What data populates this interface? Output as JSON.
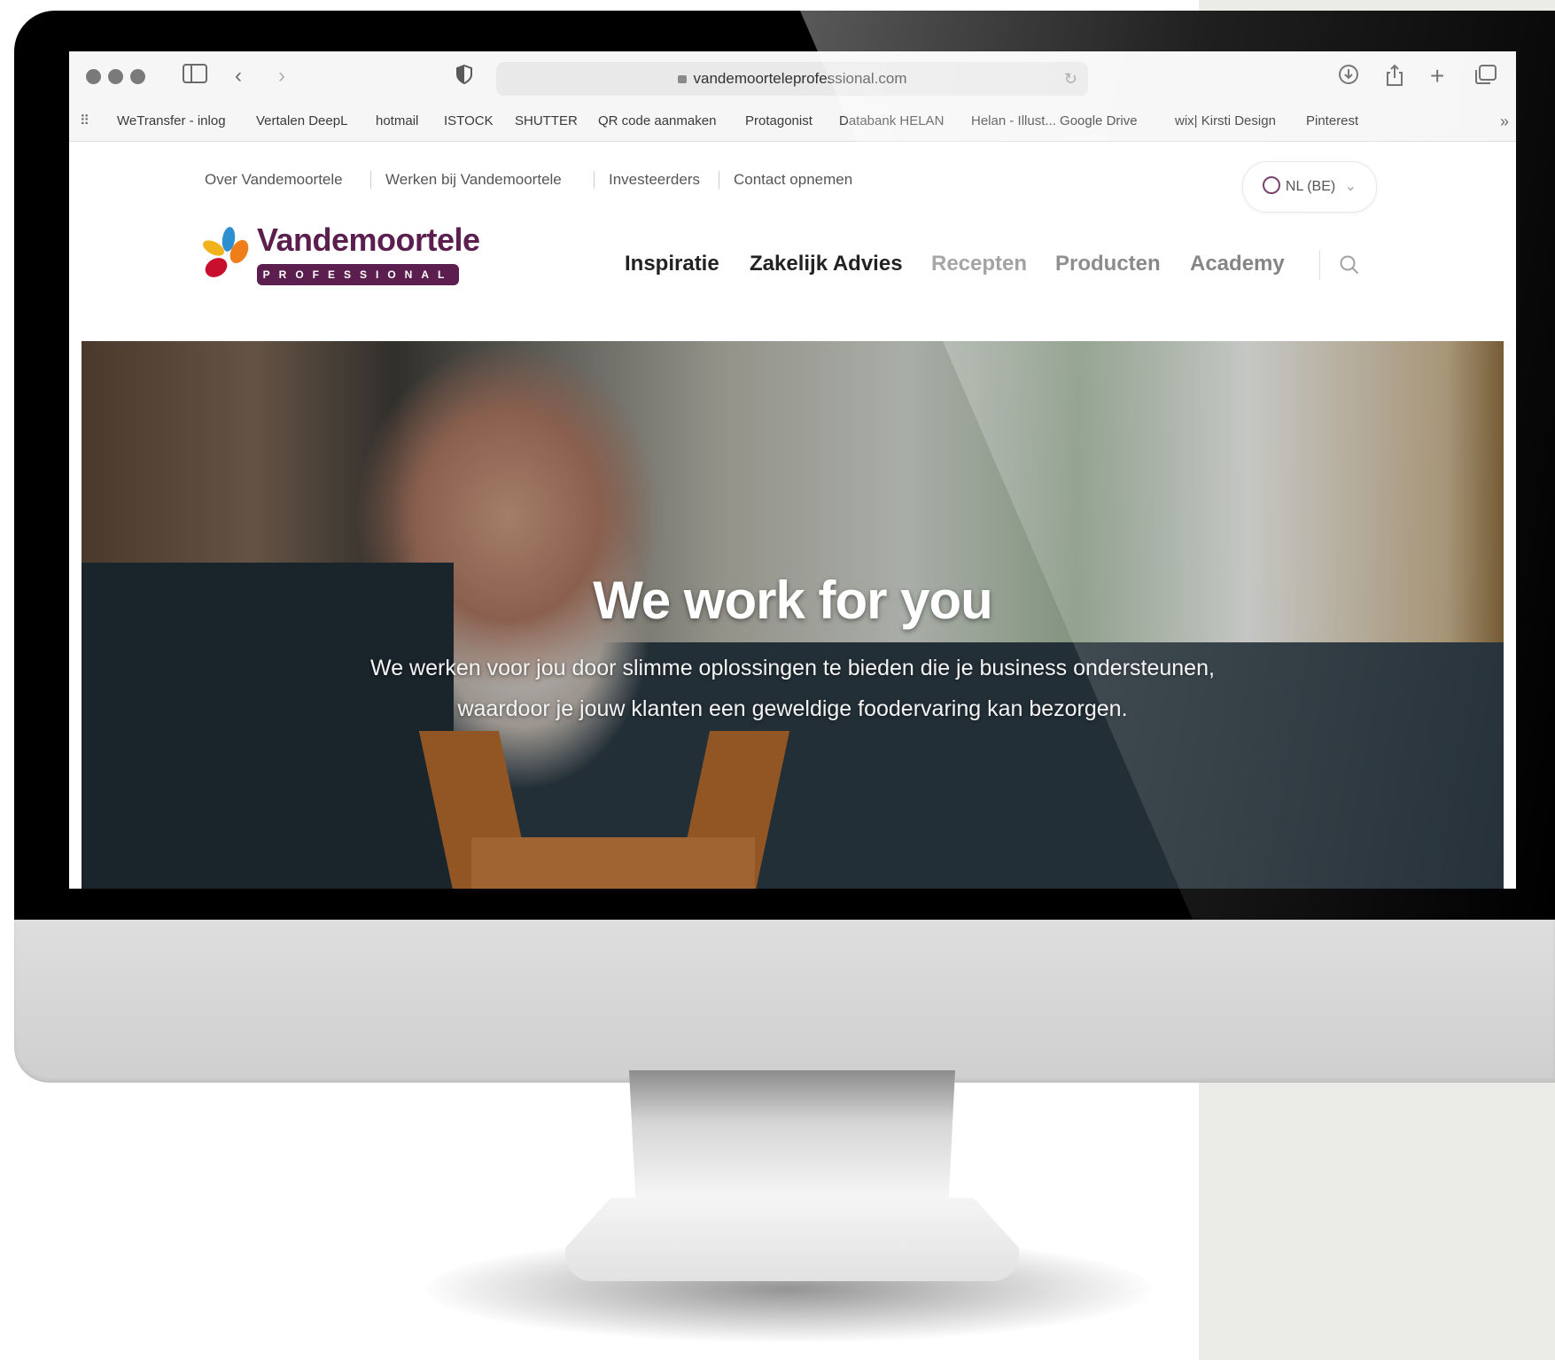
{
  "browser": {
    "url": "vandemoorteleprofessional.com",
    "bookmarks": [
      "WeTransfer - inlog",
      "Vertalen DeepL",
      "hotmail",
      "ISTOCK",
      "SHUTTER",
      "QR code aanmaken",
      "Protagonist",
      "Databank HELAN",
      "Helan - Illust... Google Drive",
      "wix| Kirsti Design",
      "Pinterest"
    ]
  },
  "site": {
    "utility_nav": [
      "Over Vandemoortele",
      "Werken bij Vandemoortele",
      "Investeerders",
      "Contact opnemen"
    ],
    "language": "NL (BE)",
    "logo": {
      "name": "Vandemoortele",
      "sub": "PROFESSIONAL"
    },
    "main_nav": [
      "Inspiratie",
      "Zakelijk Advies",
      "Recepten",
      "Producten",
      "Academy"
    ],
    "hero": {
      "title": "We work for you",
      "text_line1": "We werken voor jou door slimme oplossingen te bieden die je business ondersteunen,",
      "text_line2": "waardoor je jouw klanten een geweldige foodervaring kan bezorgen."
    }
  },
  "colors": {
    "brand": "#5b1e4e",
    "nav_active": "#222222",
    "nav_muted": "#777777"
  },
  "icons": [
    "sidebar-icon",
    "back-icon",
    "forward-icon",
    "shield-icon",
    "lock-icon",
    "reload-icon",
    "download-icon",
    "share-icon",
    "new-tab-icon",
    "tabs-icon",
    "globe-icon",
    "chevron-down-icon",
    "search-icon"
  ]
}
